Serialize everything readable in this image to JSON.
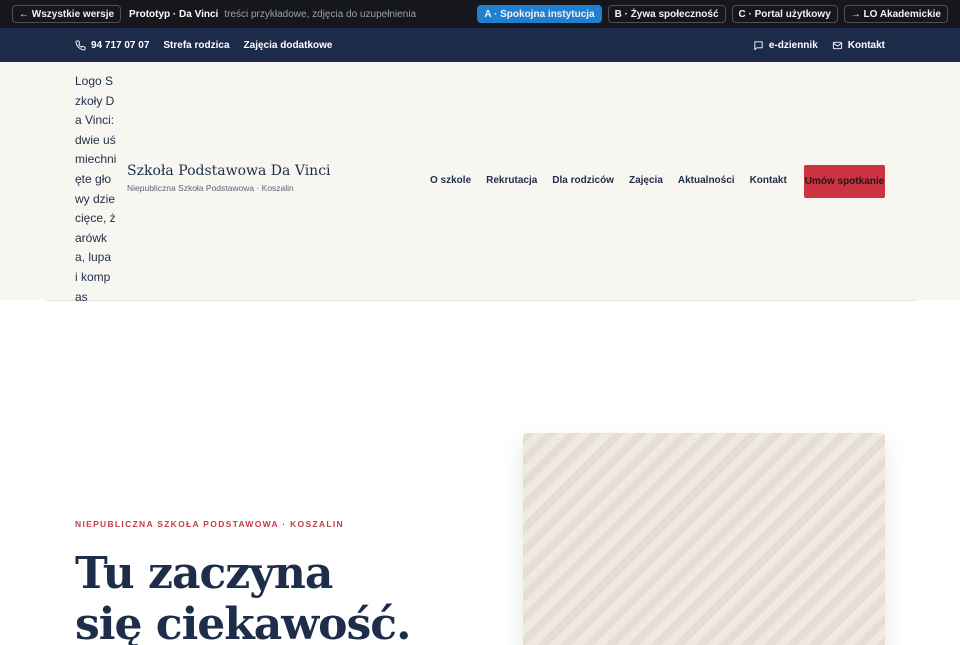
{
  "proto_bar": {
    "back_label": "← Wszystkie wersje",
    "title": "Prototyp · Da Vinci",
    "note": "treści przykładowe, zdjęcia do uzupełnienia",
    "versions": [
      {
        "label": "A · Spokojna instytucja",
        "active": true
      },
      {
        "label": "B · Żywa społeczność",
        "active": false
      },
      {
        "label": "C · Portal użytkowy",
        "active": false
      },
      {
        "label": "→ LO Akademickie",
        "active": false
      }
    ]
  },
  "util_bar": {
    "phone": "94 717 07 07",
    "parent_zone": "Strefa rodzica",
    "extra_classes": "Zajęcia dodatkowe",
    "ediary": "e-dziennik",
    "contact": "Kontakt",
    "icons": {
      "phone": "phone-icon",
      "ediary": "book-icon",
      "contact": "mail-icon"
    }
  },
  "header": {
    "logo_alt": "Logo Szkoły Da Vinci: dwie uśmiechnięte głowy dziecięce, żarówka, lupa i kompas",
    "brand_name": "Szkoła Podstawowa Da Vinci",
    "brand_sub": "Niepubliczna Szkoła Podstawowa · Koszalin",
    "nav": [
      "O szkole",
      "Rekrutacja",
      "Dla rodziców",
      "Zajęcia",
      "Aktualności",
      "Kontakt"
    ],
    "cta": "Umów spotkanie"
  },
  "hero": {
    "eyebrow": "NIEPUBLICZNA SZKOŁA PODSTAWOWA · KOSZALIN",
    "title_line1": "Tu zaczyna",
    "title_line2": "się ciekawość."
  },
  "colors": {
    "navy": "#1d2b4a",
    "accent_red": "#cc3340",
    "active_blue": "#1f7fd1",
    "header_bg": "#f8f6f1"
  }
}
